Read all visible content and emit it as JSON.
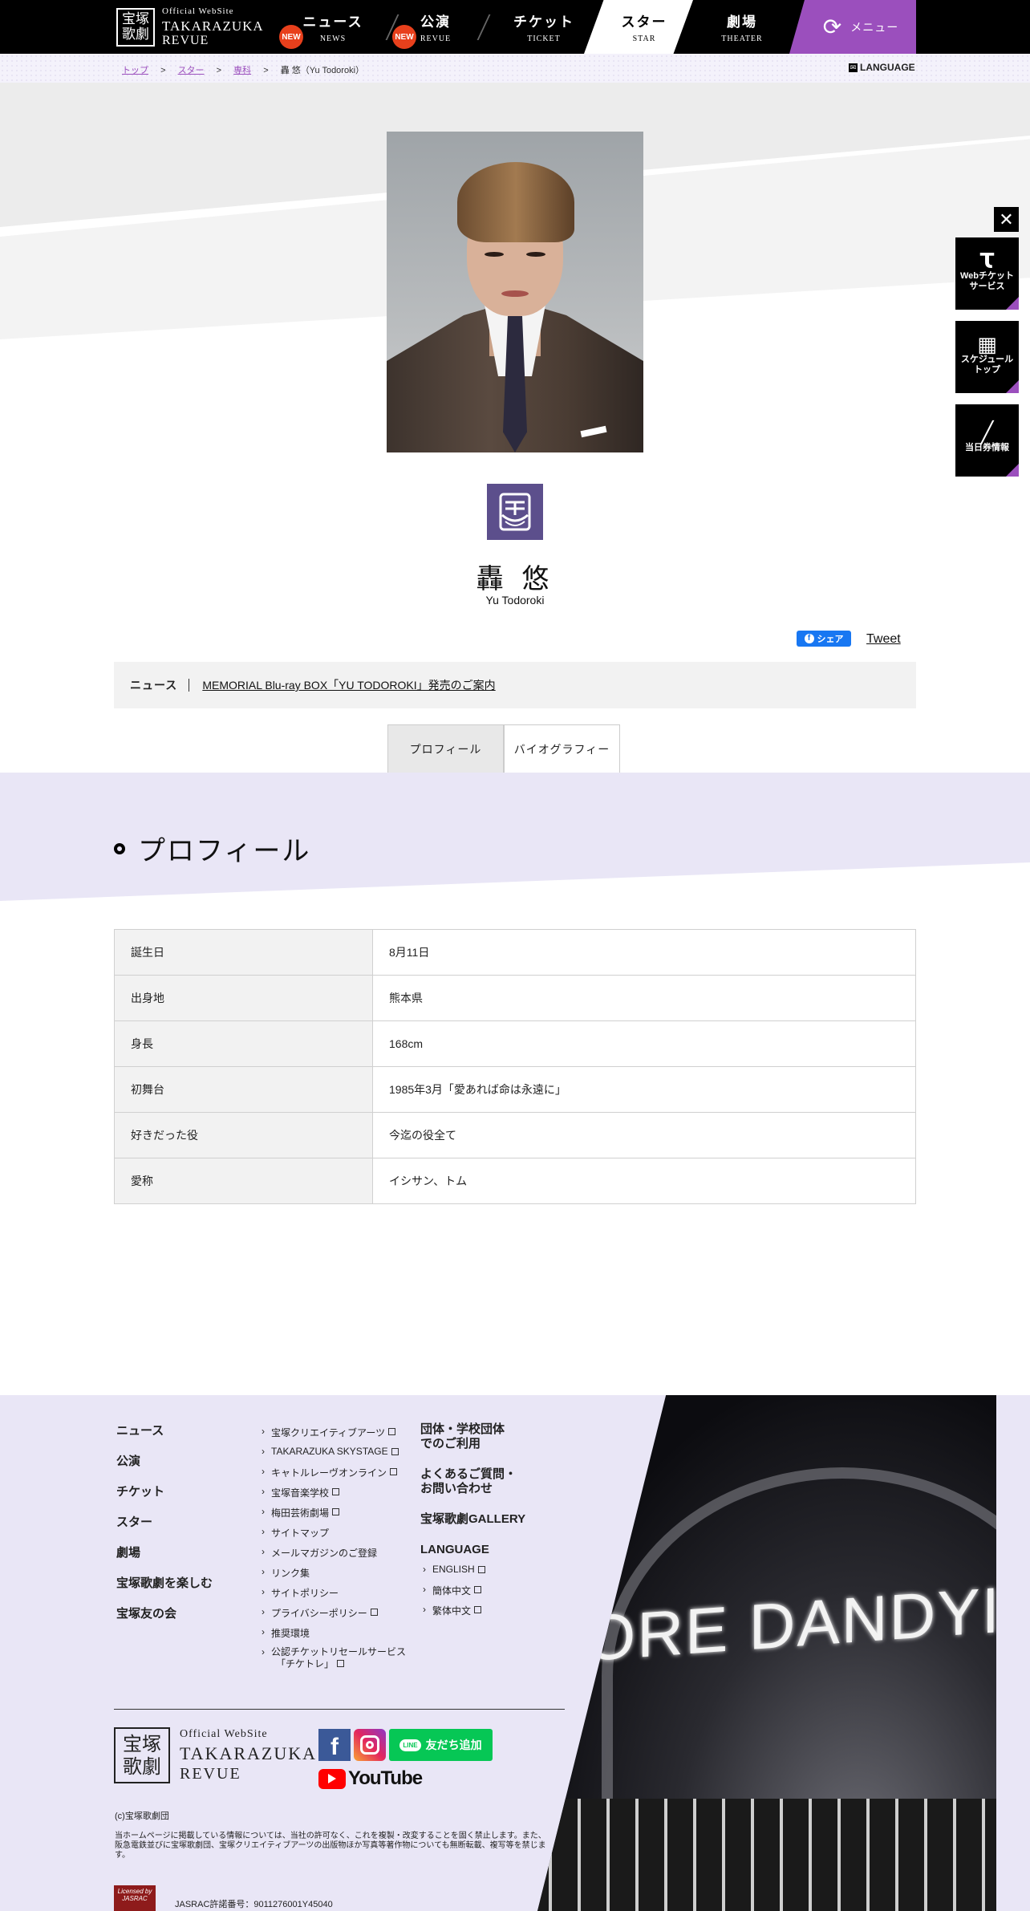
{
  "header": {
    "logo": {
      "seal_top": "宝塚",
      "seal_bottom": "歌劇",
      "line1": "Official WebSite",
      "line2": "TAKARAZUKA",
      "line3": "REVUE"
    },
    "nav": [
      {
        "jp": "ニュース",
        "en": "NEWS",
        "badge": "NEW"
      },
      {
        "jp": "公演",
        "en": "REVUE",
        "badge": "NEW"
      },
      {
        "jp": "チケット",
        "en": "TICKET"
      },
      {
        "jp": "スター",
        "en": "STAR",
        "active": true
      },
      {
        "jp": "劇場",
        "en": "THEATER"
      }
    ],
    "menu_label": "メニュー",
    "accent": "#9b4fbd"
  },
  "breadcrumb": {
    "items": [
      "トップ",
      "スター",
      "専科"
    ],
    "sep": ">",
    "current": "轟 悠（Yu Todoroki）",
    "language": "LANGUAGE"
  },
  "star": {
    "name": "轟 悠",
    "name_en": "Yu Todoroki",
    "troupe_icon": "senka-troupe-emblem"
  },
  "share": {
    "facebook": "シェア",
    "tweet": "Tweet"
  },
  "news": {
    "label": "ニュース",
    "link": "MEMORIAL Blu-ray BOX「YU TODOROKI」発売のご案内"
  },
  "tabs": [
    "プロフィール",
    "バイオグラフィー"
  ],
  "profile": {
    "title": "プロフィール",
    "rows": [
      {
        "k": "誕生日",
        "v": "8月11日"
      },
      {
        "k": "出身地",
        "v": "熊本県"
      },
      {
        "k": "身長",
        "v": "168cm"
      },
      {
        "k": "初舞台",
        "v": "1985年3月「愛あれば命は永遠に」"
      },
      {
        "k": "好きだった役",
        "v": "今迄の役全て"
      },
      {
        "k": "愛称",
        "v": "イシサン、トム"
      }
    ]
  },
  "floating": {
    "close": "✕",
    "buttons": [
      "Webチケット\nサービス",
      "スケジュール\nトップ",
      "当日券情報"
    ]
  },
  "footer": {
    "col1": [
      "ニュース",
      "公演",
      "チケット",
      "スター",
      "劇場",
      "宝塚歌劇を楽しむ",
      "宝塚友の会"
    ],
    "col2": [
      {
        "t": "宝塚クリエイティブアーツ",
        "ext": true
      },
      {
        "t": "TAKARAZUKA SKYSTAGE",
        "ext": true
      },
      {
        "t": "キャトルレーヴオンライン",
        "ext": true
      },
      {
        "t": "宝塚音楽学校",
        "ext": true
      },
      {
        "t": "梅田芸術劇場",
        "ext": true
      },
      {
        "t": "サイトマップ",
        "ext": false
      },
      {
        "t": "メールマガジンのご登録",
        "ext": false
      },
      {
        "t": "リンク集",
        "ext": false
      },
      {
        "t": "サイトポリシー",
        "ext": false
      },
      {
        "t": "プライバシーポリシー",
        "ext": true
      },
      {
        "t": "推奨環境",
        "ext": false
      },
      {
        "t": "公認チケットリセールサービス",
        "ext": false
      }
    ],
    "col2_last_line2": "「チケトレ」",
    "col3": [
      {
        "l1": "団体・学校団体",
        "l2": "でのご利用"
      },
      {
        "l1": "よくあるご質問・",
        "l2": "お問い合わせ"
      },
      {
        "l1": "宝塚歌劇GALLERY",
        "l2": ""
      },
      {
        "l1": "LANGUAGE",
        "l2": ""
      }
    ],
    "languages": [
      "ENGLISH",
      "簡体中文",
      "繁体中文"
    ],
    "logo": {
      "seal_top": "宝塚",
      "seal_bottom": "歌劇",
      "line1": "Official WebSite",
      "line2": "TAKARAZUKA",
      "line3": "REVUE"
    },
    "sns": {
      "line": "友だち追加",
      "line_badge": "LINE",
      "youtube": "YouTube"
    },
    "copyright": "(c)宝塚歌劇団",
    "notice": "当ホームページに掲載している情報については、当社の許可なく、これを複製・改変することを固く禁止します。また、阪急電鉄並びに宝塚歌劇団、宝塚クリエイティブアーツの出版物ほか写真等著作物についても無断転載、複写等を禁じます。",
    "jasrac_logo": "Licensed by JASRAC",
    "jasrac": "JASRAC許諾番号：9011276001Y45040",
    "photo_sign": "ORE DANDYIS"
  }
}
